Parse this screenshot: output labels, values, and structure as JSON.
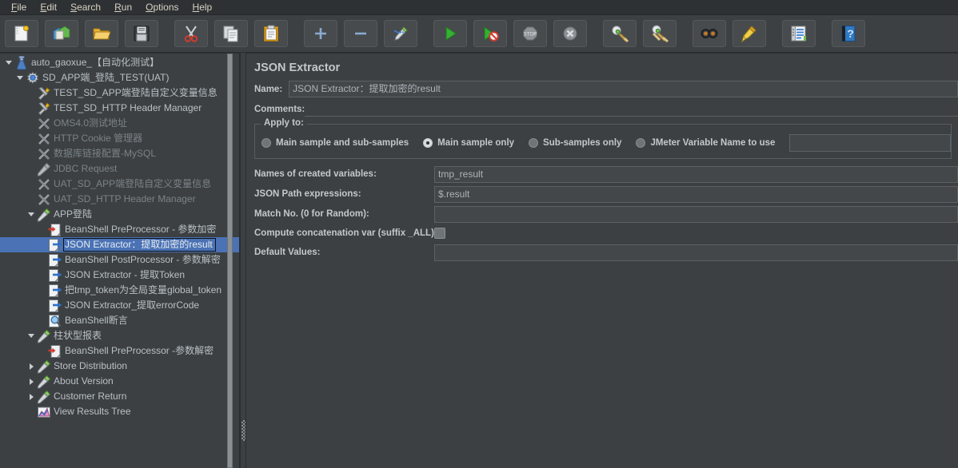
{
  "menubar": {
    "items": [
      {
        "name": "file",
        "mnemonic": "F",
        "rest": "ile"
      },
      {
        "name": "edit",
        "mnemonic": "E",
        "rest": "dit"
      },
      {
        "name": "search",
        "mnemonic": "S",
        "rest": "earch"
      },
      {
        "name": "run",
        "mnemonic": "R",
        "rest": "un"
      },
      {
        "name": "options",
        "mnemonic": "O",
        "rest": "ptions"
      },
      {
        "name": "help",
        "mnemonic": "H",
        "rest": "elp"
      }
    ]
  },
  "toolbar": {
    "buttons": [
      {
        "icon": "new-icon",
        "title": "New"
      },
      {
        "icon": "templates-icon",
        "title": "Templates"
      },
      {
        "icon": "open-icon",
        "title": "Open"
      },
      {
        "icon": "save-icon",
        "title": "Save Test Plan"
      },
      {
        "icon": "cut-icon",
        "title": "Cut"
      },
      {
        "icon": "copy-icon",
        "title": "Copy"
      },
      {
        "icon": "paste-icon",
        "title": "Paste"
      },
      {
        "icon": "expand-all-icon",
        "title": "Expand All"
      },
      {
        "icon": "collapse-all-icon",
        "title": "Collapse All"
      },
      {
        "icon": "toggle-icon",
        "title": "Toggle"
      },
      {
        "icon": "start-icon",
        "title": "Start"
      },
      {
        "icon": "start-no-pauses-icon",
        "title": "Start no pauses"
      },
      {
        "icon": "stop-icon",
        "title": "Stop"
      },
      {
        "icon": "shutdown-icon",
        "title": "Shutdown"
      },
      {
        "icon": "clear-icon",
        "title": "Clear"
      },
      {
        "icon": "clear-all-icon",
        "title": "Clear All"
      },
      {
        "icon": "search-icon",
        "title": "Search"
      },
      {
        "icon": "search-reset-icon",
        "title": "Reset Search"
      },
      {
        "icon": "function-helper-icon",
        "title": "Function Helper Dialog"
      },
      {
        "icon": "help-icon",
        "title": "Help"
      }
    ]
  },
  "tree": {
    "nodes": [
      {
        "label": "auto_gaoxue_【自动化测试】",
        "depth": 0,
        "toggle": "down",
        "icon": "test-plan-icon",
        "disabled": false,
        "selected": false
      },
      {
        "label": "SD_APP端_登陆_TEST(UAT)",
        "depth": 1,
        "toggle": "down",
        "icon": "thread-group-icon",
        "disabled": false,
        "selected": false
      },
      {
        "label": "TEST_SD_APP端登陆自定义变量信息",
        "depth": 2,
        "toggle": "none",
        "icon": "config-icon",
        "disabled": false,
        "selected": false
      },
      {
        "label": "TEST_SD_HTTP Header Manager",
        "depth": 2,
        "toggle": "none",
        "icon": "config-icon",
        "disabled": false,
        "selected": false
      },
      {
        "label": "OMS4.0测试地址",
        "depth": 2,
        "toggle": "none",
        "icon": "config-off-icon",
        "disabled": true,
        "selected": false
      },
      {
        "label": "HTTP Cookie 管理器",
        "depth": 2,
        "toggle": "none",
        "icon": "config-off-icon",
        "disabled": true,
        "selected": false
      },
      {
        "label": "数据库链接配置-MySQL",
        "depth": 2,
        "toggle": "none",
        "icon": "config-off-icon",
        "disabled": true,
        "selected": false
      },
      {
        "label": "JDBC Request",
        "depth": 2,
        "toggle": "none",
        "icon": "sampler-off-icon",
        "disabled": true,
        "selected": false
      },
      {
        "label": "UAT_SD_APP端登陆自定义变量信息",
        "depth": 2,
        "toggle": "none",
        "icon": "config-off-icon",
        "disabled": true,
        "selected": false
      },
      {
        "label": "UAT_SD_HTTP Header Manager",
        "depth": 2,
        "toggle": "none",
        "icon": "config-off-icon",
        "disabled": true,
        "selected": false
      },
      {
        "label": "APP登陆",
        "depth": 2,
        "toggle": "down",
        "icon": "sampler-icon",
        "disabled": false,
        "selected": false
      },
      {
        "label": "BeanShell PreProcessor - 参数加密",
        "depth": 3,
        "toggle": "none",
        "icon": "preprocessor-icon",
        "disabled": false,
        "selected": false
      },
      {
        "label": "JSON Extractor：提取加密的result",
        "depth": 3,
        "toggle": "none",
        "icon": "postprocessor-icon",
        "disabled": false,
        "selected": true
      },
      {
        "label": "BeanShell PostProcessor - 参数解密",
        "depth": 3,
        "toggle": "none",
        "icon": "postprocessor-icon",
        "disabled": false,
        "selected": false
      },
      {
        "label": "JSON Extractor - 提取Token",
        "depth": 3,
        "toggle": "none",
        "icon": "postprocessor-icon",
        "disabled": false,
        "selected": false
      },
      {
        "label": "把tmp_token为全局变量global_token",
        "depth": 3,
        "toggle": "none",
        "icon": "postprocessor-icon",
        "disabled": false,
        "selected": false
      },
      {
        "label": "JSON Extractor_提取errorCode",
        "depth": 3,
        "toggle": "none",
        "icon": "postprocessor-icon",
        "disabled": false,
        "selected": false
      },
      {
        "label": "BeanShell断言",
        "depth": 3,
        "toggle": "none",
        "icon": "assertion-icon",
        "disabled": false,
        "selected": false
      },
      {
        "label": "柱状型报表",
        "depth": 2,
        "toggle": "down",
        "icon": "sampler-icon",
        "disabled": false,
        "selected": false
      },
      {
        "label": "BeanShell PreProcessor -参数解密",
        "depth": 3,
        "toggle": "none",
        "icon": "preprocessor-icon",
        "disabled": false,
        "selected": false
      },
      {
        "label": "Store Distribution",
        "depth": 2,
        "toggle": "right",
        "icon": "sampler-icon",
        "disabled": false,
        "selected": false
      },
      {
        "label": "About Version",
        "depth": 2,
        "toggle": "right",
        "icon": "sampler-icon",
        "disabled": false,
        "selected": false
      },
      {
        "label": "Customer Return",
        "depth": 2,
        "toggle": "right",
        "icon": "sampler-icon",
        "disabled": false,
        "selected": false
      },
      {
        "label": "View Results Tree",
        "depth": 2,
        "toggle": "none",
        "icon": "listener-icon",
        "disabled": false,
        "selected": false
      }
    ]
  },
  "panel": {
    "title": "JSON Extractor",
    "name_label": "Name:",
    "name_value": "JSON Extractor：提取加密的result",
    "comments_label": "Comments:",
    "comments_value": "",
    "apply_to": {
      "group_title": "Apply to:",
      "options": [
        {
          "label": "Main sample and sub-samples",
          "selected": false
        },
        {
          "label": "Main sample only",
          "selected": true
        },
        {
          "label": "Sub-samples only",
          "selected": false
        },
        {
          "label": "JMeter Variable Name to use",
          "selected": false
        }
      ],
      "variable_name_value": ""
    },
    "fields": [
      {
        "label": "Names of created variables:",
        "value": "tmp_result",
        "type": "text"
      },
      {
        "label": "JSON Path expressions:",
        "value": "$.result",
        "type": "text"
      },
      {
        "label": "Match No. (0 for Random):",
        "value": "",
        "type": "text"
      },
      {
        "label": "Compute concatenation var (suffix _ALL):",
        "value": "",
        "type": "checkbox",
        "checked": false
      },
      {
        "label": "Default Values:",
        "value": "",
        "type": "text"
      }
    ]
  },
  "colors": {
    "background": "#3c4042",
    "menubar_bg": "#2e3133",
    "selection_blue": "#4a72b5",
    "text": "#c3c8cd",
    "text_disabled": "#7b8288",
    "field_bg": "#43474a",
    "border": "#5c6165"
  }
}
